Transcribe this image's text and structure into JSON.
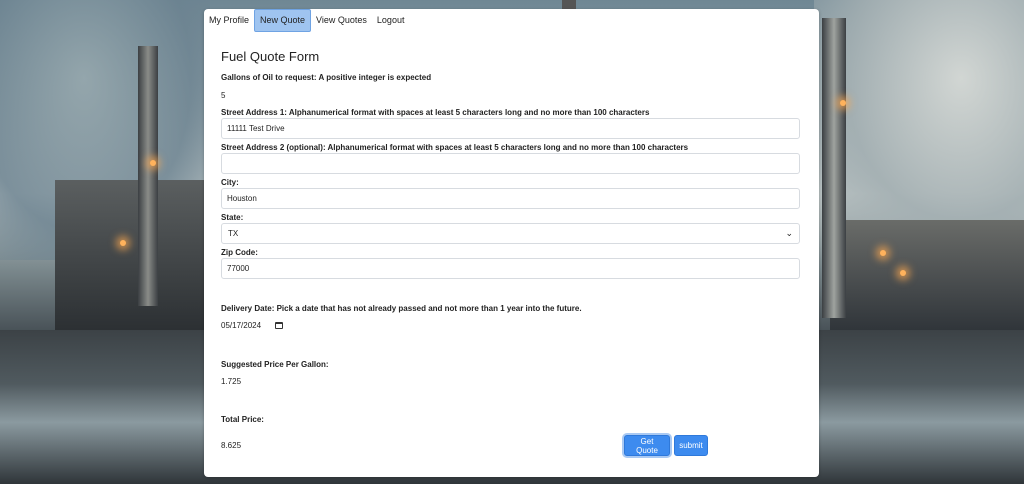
{
  "nav": {
    "items": [
      "My Profile",
      "New Quote",
      "View Quotes",
      "Logout"
    ],
    "active_index": 1
  },
  "form": {
    "title": "Fuel Quote Form",
    "gallons": {
      "label": "Gallons of Oil to request: A positive integer is expected",
      "value": "5"
    },
    "address1": {
      "label": "Street Address 1: Alphanumerical format with spaces at least 5 characters long and no more than 100 characters",
      "value": "11111 Test Drive"
    },
    "address2": {
      "label": "Street Address 2 (optional): Alphanumerical format with spaces at least 5 characters long and no more than 100 characters",
      "value": ""
    },
    "city": {
      "label": "City:",
      "value": "Houston"
    },
    "state": {
      "label": "State:",
      "value": "TX"
    },
    "zip": {
      "label": "Zip Code:",
      "value": "77000"
    },
    "delivery": {
      "label": "Delivery Date: Pick a date that has not already passed and not more than 1 year into the future.",
      "value": "05/17/2024"
    },
    "suggested": {
      "label": "Suggested Price Per Gallon:",
      "value": "1.725"
    },
    "total": {
      "label": "Total Price:",
      "value": "8.625"
    },
    "buttons": {
      "get_quote": "Get Quote",
      "submit": "submit"
    }
  },
  "colors": {
    "accent": "#3d8bef",
    "nav_active": "#9fc4f0"
  }
}
